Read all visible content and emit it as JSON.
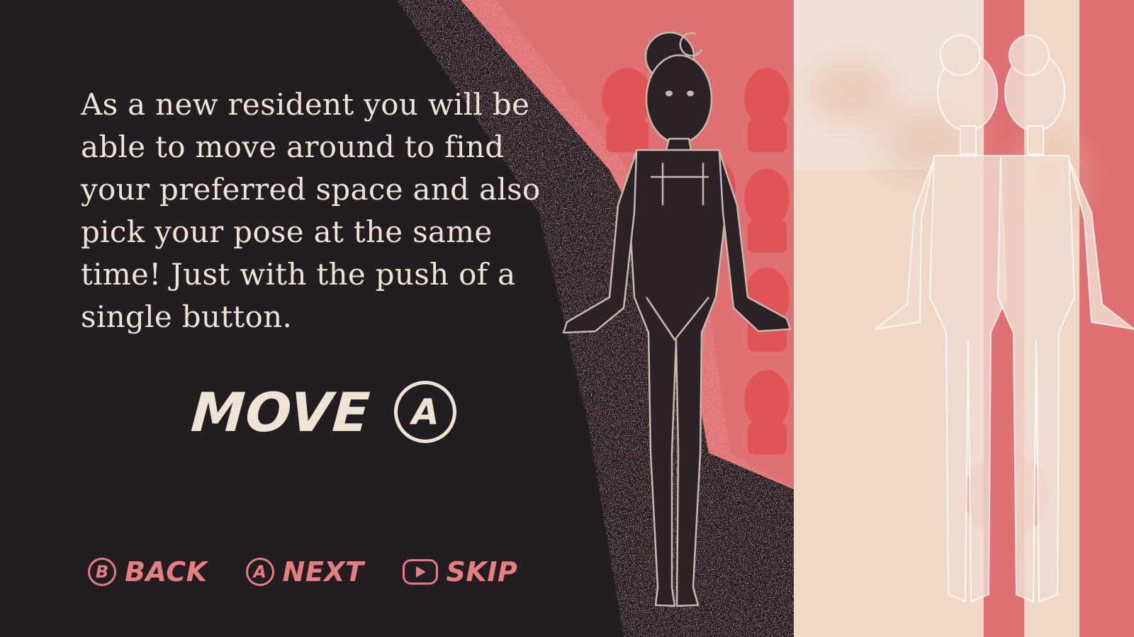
{
  "tutorial": {
    "body_text": "As a new resident you will be able to move around to find your preferred space and also pick your pose at the same time! Just with the push of a single button."
  },
  "prompt": {
    "action_label": "MOVE",
    "button_glyph": "A"
  },
  "nav": {
    "back": {
      "glyph": "B",
      "label": "BACK"
    },
    "next": {
      "glyph": "A",
      "label": "NEXT"
    },
    "skip": {
      "label": "SKIP",
      "icon": "play-icon"
    }
  },
  "colors": {
    "background_dark": "#211d20",
    "salmon_pink": "#df7174",
    "cream": "#efe3d6",
    "nav_pink": "#e57e80"
  }
}
